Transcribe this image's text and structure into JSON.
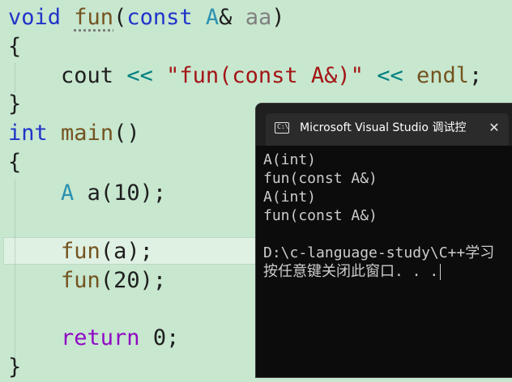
{
  "code": {
    "l1": {
      "kw": "void",
      "fn": "fun",
      "open": "(",
      "const": "const",
      "cls": "A",
      "amp": "&",
      "param": "aa",
      "close": ")"
    },
    "l2": "{",
    "l3": {
      "cout": "cout",
      "op1": "<<",
      "str": "\"fun(const A&)\"",
      "op2": "<<",
      "endl": "endl",
      "semi": ";"
    },
    "l4": "}",
    "l5": {
      "kw": "int",
      "fn": "main",
      "paren": "()"
    },
    "l6": "{",
    "l7": {
      "cls": "A",
      "var": "a",
      "args": "(10);"
    },
    "l9": {
      "fn": "fun",
      "open": "(",
      "arg": "a",
      "close": ");"
    },
    "l10": {
      "fn": "fun",
      "args": "(20);"
    },
    "l12": {
      "kw": "return",
      "val": "0;"
    },
    "l13": "}"
  },
  "console": {
    "title": "Microsoft Visual Studio 调试控制台",
    "close_glyph": "✕",
    "icon_text": "C:\\",
    "lines": [
      "A(int)",
      "fun(const A&)",
      "A(int)",
      "fun(const A&)",
      "",
      "D:\\c-language-study\\C++学习",
      "按任意键关闭此窗口. . ."
    ]
  }
}
